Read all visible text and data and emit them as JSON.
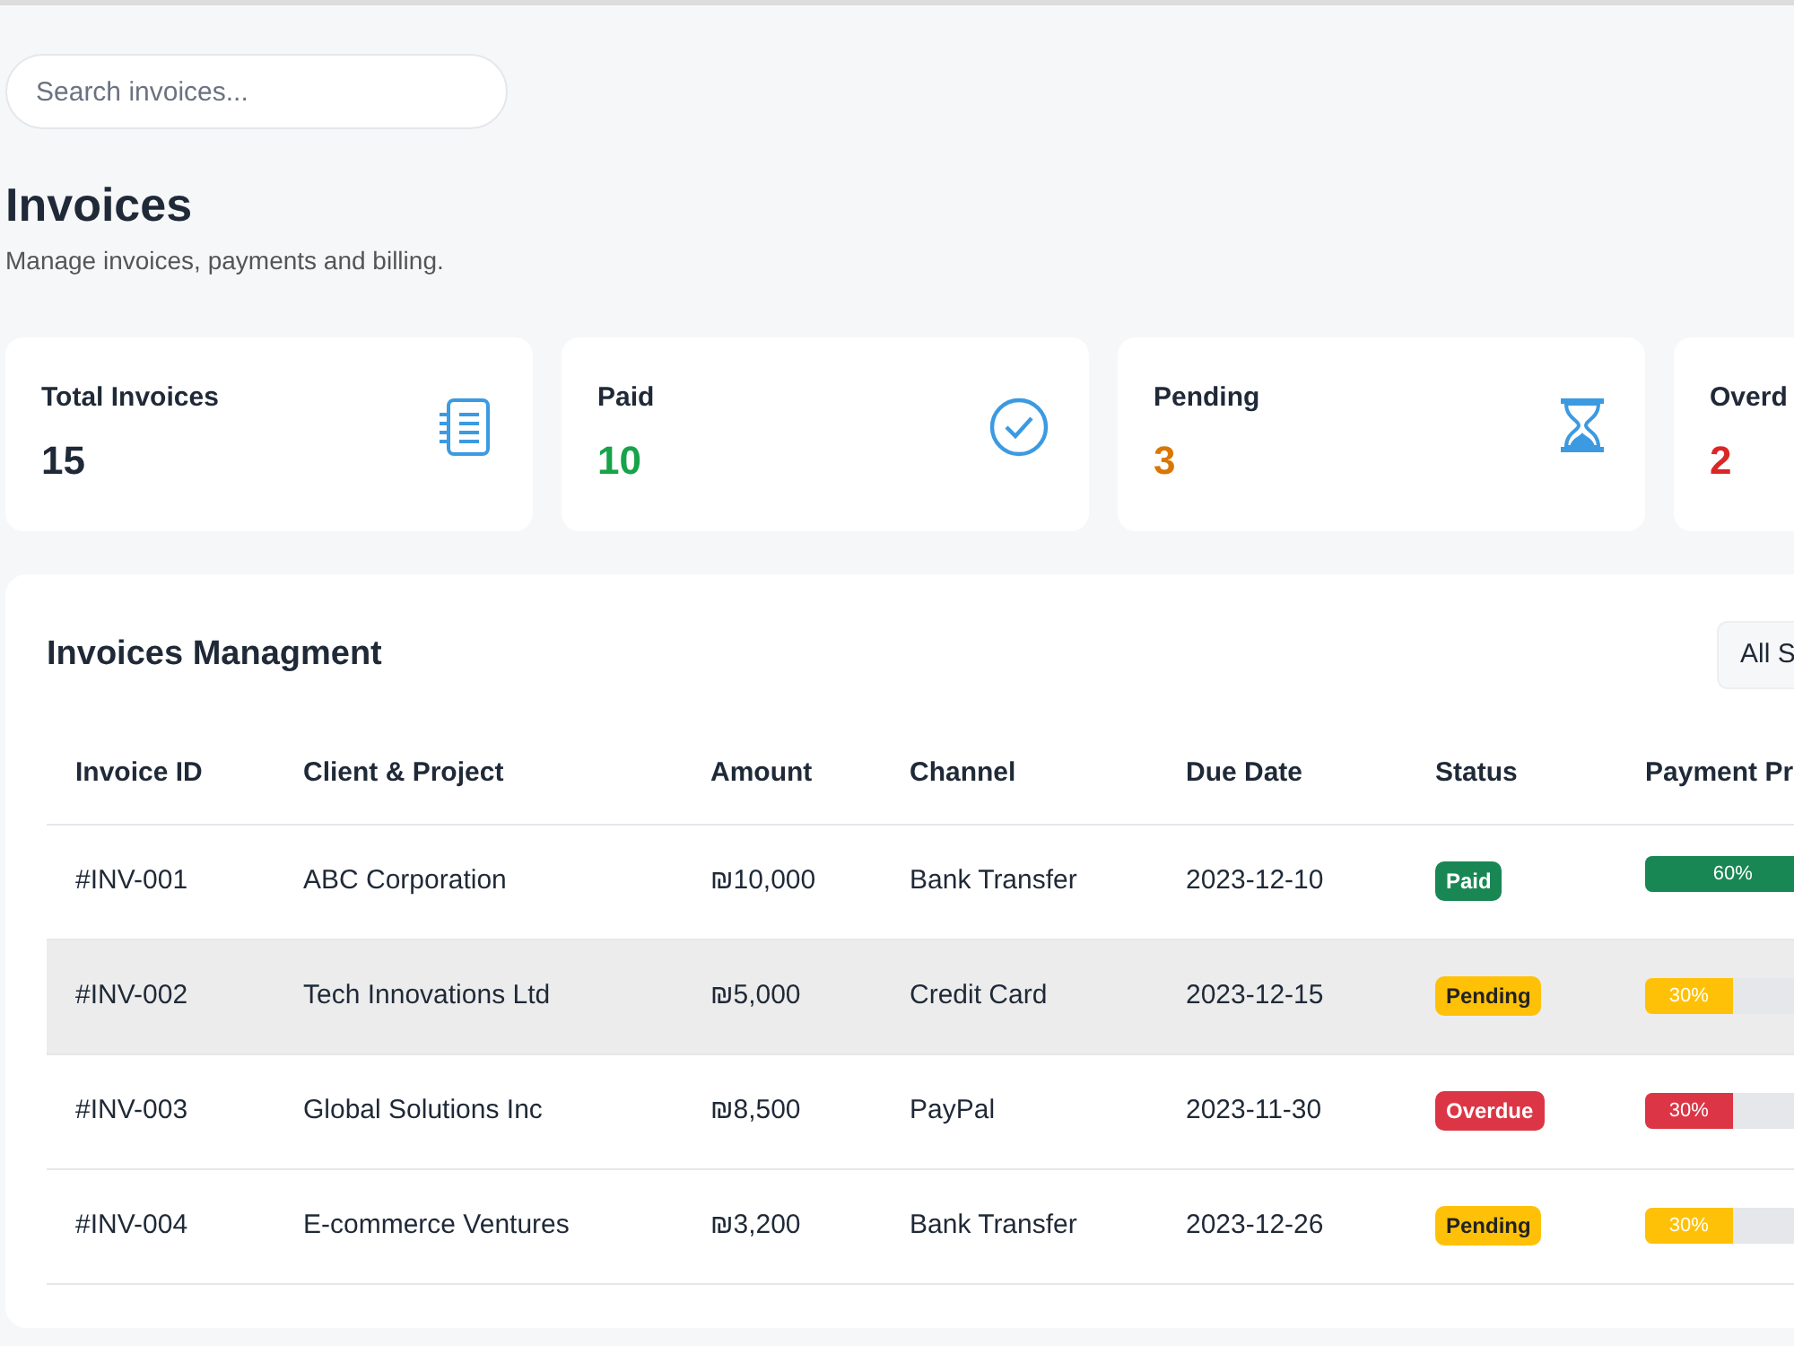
{
  "search": {
    "placeholder": "Search invoices..."
  },
  "header": {
    "title": "Invoices",
    "subtitle": "Manage invoices, payments and billing."
  },
  "stats": [
    {
      "label": "Total Invoices",
      "value": "15",
      "kind": "total"
    },
    {
      "label": "Paid",
      "value": "10",
      "kind": "paid"
    },
    {
      "label": "Pending",
      "value": "3",
      "kind": "pending"
    },
    {
      "label": "Overd",
      "value": "2",
      "kind": "overdue"
    }
  ],
  "table": {
    "title": "Invoices Managment",
    "filter": "All S",
    "columns": [
      "Invoice ID",
      "Client & Project",
      "Amount",
      "Channel",
      "Due Date",
      "Status",
      "Payment Pr"
    ],
    "rows": [
      {
        "id": "#INV-001",
        "client": "ABC Corporation",
        "amount": "₪10,000",
        "channel": "Bank Transfer",
        "due": "2023-12-10",
        "status": "Paid",
        "kind": "paid",
        "level": 0.6,
        "reading": "60%",
        "selected": false
      },
      {
        "id": "#INV-002",
        "client": "Tech Innovations Ltd",
        "amount": "₪5,000",
        "channel": "Credit Card",
        "due": "2023-12-15",
        "status": "Pending",
        "kind": "pending",
        "level": 0.3,
        "reading": "30%",
        "selected": true
      },
      {
        "id": "#INV-003",
        "client": "Global Solutions Inc",
        "amount": "₪8,500",
        "channel": "PayPal",
        "due": "2023-11-30",
        "status": "Overdue",
        "kind": "overdue",
        "level": 0.3,
        "reading": "30%",
        "selected": false
      },
      {
        "id": "#INV-004",
        "client": "E-commerce Ventures",
        "amount": "₪3,200",
        "channel": "Bank Transfer",
        "due": "2023-12-26",
        "status": "Pending",
        "kind": "pending",
        "level": 0.3,
        "reading": "30%",
        "selected": false
      }
    ]
  }
}
